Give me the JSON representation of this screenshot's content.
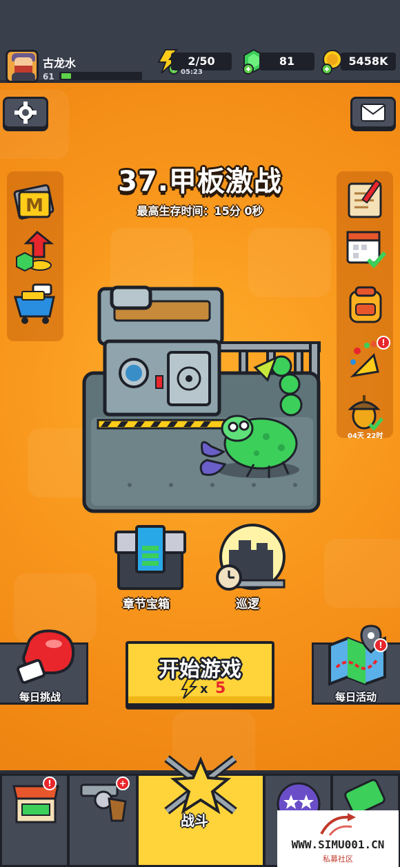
{
  "player": {
    "name": "古龙水",
    "level": "61",
    "xp_fraction": 0.12
  },
  "resources": {
    "energy": "2/50",
    "energy_timer": "05:23",
    "gems": "81",
    "coins": "5458K"
  },
  "stage": {
    "title": "37.甲板激战",
    "best_time": "最高生存时间：15分 0秒"
  },
  "right_panel": {
    "acorn_timer": "04天 22时",
    "badge": "!"
  },
  "mid_buttons": {
    "chapter_chest": "章节宝箱",
    "patrol": "巡逻"
  },
  "actions": {
    "daily_challenge": "每日挑战",
    "start_game": "开始游戏",
    "cost_x": "x",
    "cost_value": "5",
    "daily_event": "每日活动"
  },
  "nav": {
    "battle": "战斗",
    "shop_badge": "!",
    "weapon_badge": "+"
  },
  "watermark": {
    "url": "WWW.SIMU001.CN",
    "sub": "私募社区"
  },
  "colors": {
    "background": "#f28a12",
    "topbar": "#3a3f4c",
    "start_button": "#ffd43a",
    "badge": "#e8262c"
  }
}
